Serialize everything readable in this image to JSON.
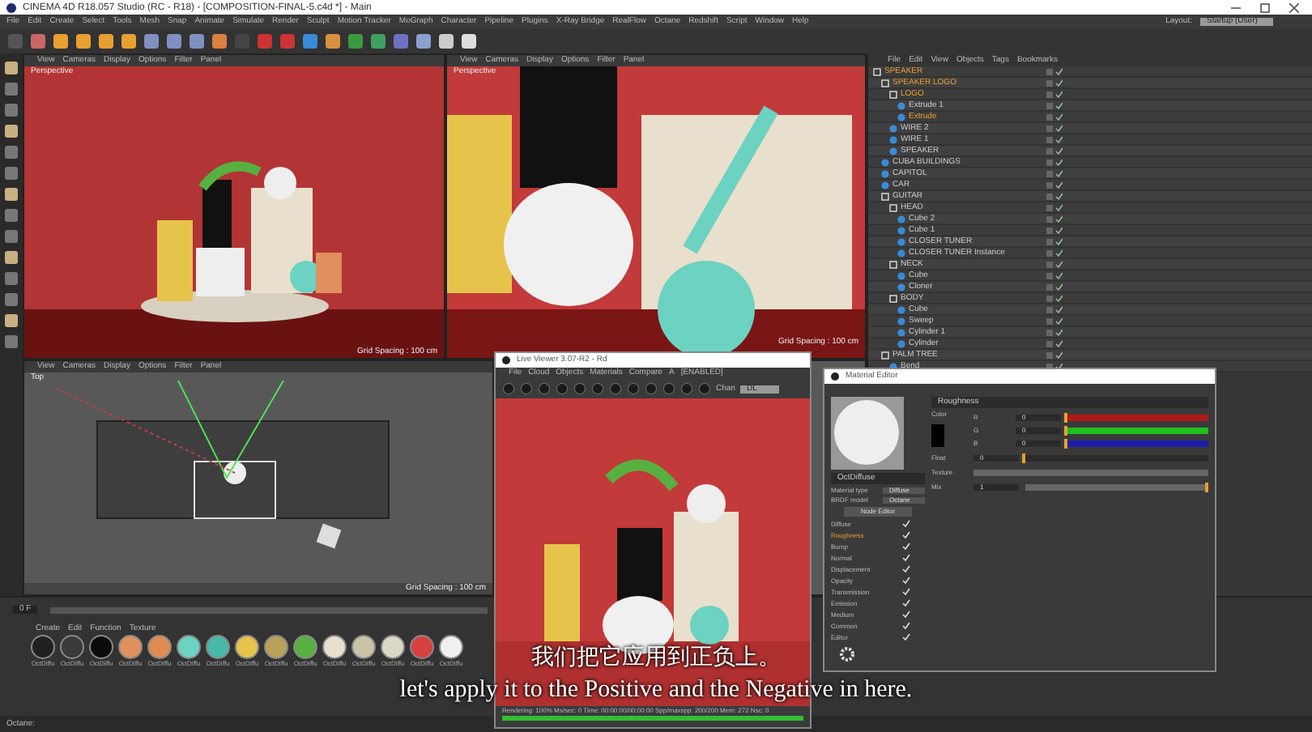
{
  "window": {
    "title": "CINEMA 4D R18.057 Studio (RC - R18) - [COMPOSITION-FINAL-5.c4d *] - Main"
  },
  "menu_bar": [
    "File",
    "Edit",
    "Create",
    "Select",
    "Tools",
    "Mesh",
    "Snap",
    "Animate",
    "Simulate",
    "Render",
    "Sculpt",
    "Motion Tracker",
    "MoGraph",
    "Character",
    "Pipeline",
    "Plugins",
    "X-Ray Bridge",
    "RealFlow",
    "Octane",
    "Redshift",
    "Script",
    "Window",
    "Help"
  ],
  "layout": {
    "label": "Layout:",
    "value": "Startup (User)"
  },
  "viewports": [
    {
      "kind": "perspective",
      "menu": [
        "View",
        "Cameras",
        "Display",
        "Options",
        "Filter",
        "Panel"
      ],
      "label": "Perspective",
      "grid": "Grid Spacing : 100 cm"
    },
    {
      "kind": "closeup",
      "menu": [
        "View",
        "Cameras",
        "Display",
        "Options",
        "Filter",
        "Panel"
      ],
      "label": "Perspective",
      "grid": "Grid Spacing : 100 cm"
    },
    {
      "kind": "top",
      "menu": [
        "View",
        "Cameras",
        "Display",
        "Options",
        "Filter",
        "Panel"
      ],
      "label": "Top",
      "grid": "Grid Spacing : 100 cm"
    }
  ],
  "object_manager": {
    "menu": [
      "File",
      "Edit",
      "View",
      "Objects",
      "Tags",
      "Bookmarks"
    ],
    "items": [
      {
        "name": "SPEAKER",
        "selected": true,
        "children": [
          {
            "name": "SPEAKER LOGO",
            "selected": true,
            "children": [
              {
                "name": "LOGO",
                "selected": true,
                "children": [
                  {
                    "name": "Extrude 1",
                    "selected": false
                  },
                  {
                    "name": "Extrude",
                    "selected": true
                  }
                ]
              },
              {
                "name": "WIRE 2",
                "selected": false
              },
              {
                "name": "WIRE 1",
                "selected": false
              },
              {
                "name": "SPEAKER",
                "selected": false
              }
            ]
          },
          {
            "name": "CUBA BUILDINGS",
            "selected": false
          },
          {
            "name": "CAPITOL",
            "selected": false
          },
          {
            "name": "CAR",
            "selected": false
          },
          {
            "name": "GUITAR",
            "selected": false,
            "children": [
              {
                "name": "HEAD",
                "selected": false,
                "children": [
                  {
                    "name": "Cube 2",
                    "selected": false
                  },
                  {
                    "name": "Cube 1",
                    "selected": false
                  },
                  {
                    "name": "CLOSER TUNER",
                    "selected": false
                  },
                  {
                    "name": "CLOSER TUNER Instance",
                    "selected": false
                  }
                ]
              },
              {
                "name": "NECK",
                "selected": false,
                "children": [
                  {
                    "name": "Cube",
                    "selected": false
                  },
                  {
                    "name": "Cloner",
                    "selected": false
                  }
                ]
              },
              {
                "name": "BODY",
                "selected": false,
                "children": [
                  {
                    "name": "Cube",
                    "selected": false
                  },
                  {
                    "name": "Sweep",
                    "selected": false
                  },
                  {
                    "name": "Cylinder 1",
                    "selected": false
                  },
                  {
                    "name": "Cylinder",
                    "selected": false
                  }
                ]
              }
            ]
          },
          {
            "name": "PALM TREE",
            "selected": false,
            "children": [
              {
                "name": "Bend",
                "selected": false
              }
            ]
          }
        ]
      }
    ]
  },
  "live_viewer": {
    "title": "Live Viewer 3.07-R2 - Rd",
    "menu": [
      "File",
      "Cloud",
      "Objects",
      "Materials",
      "Compare",
      "A",
      "[ENABLED]"
    ],
    "channel": {
      "label": "Chan",
      "value": "DL"
    },
    "status": "Rendering: 100%  Ms/sec: 0  Time: 00:00:00/00:00:00  Spp/maxspp: 200/200  Mem: 272  Nsc: 0",
    "progress": {
      "level": 1
    }
  },
  "material_editor": {
    "title": "Material Editor",
    "material_name": "OctDiffuse",
    "fields": [
      {
        "label": "Material type",
        "value": "Diffuse"
      },
      {
        "label": "BRDF model",
        "value": "Octane"
      }
    ],
    "node_editor": "Node Editor",
    "channels": [
      {
        "label": "Diffuse",
        "selected": false,
        "checked": true
      },
      {
        "label": "Roughness",
        "selected": true,
        "checked": true
      },
      {
        "label": "Bump",
        "selected": false,
        "checked": true
      },
      {
        "label": "Normal",
        "selected": false,
        "checked": true
      },
      {
        "label": "Displacement",
        "selected": false,
        "checked": true
      },
      {
        "label": "Opacity",
        "selected": false,
        "checked": true
      },
      {
        "label": "Transmission",
        "selected": false,
        "checked": true
      },
      {
        "label": "Emission",
        "selected": false,
        "checked": true
      },
      {
        "label": "Medium",
        "selected": false,
        "checked": true
      },
      {
        "label": "Common",
        "selected": false,
        "checked": true
      },
      {
        "label": "Editor",
        "selected": false,
        "checked": true
      }
    ],
    "section": "Roughness",
    "color_label": "Color",
    "rgb": [
      {
        "prefix": "R",
        "value": "0",
        "level": 0,
        "color": "#b01818"
      },
      {
        "prefix": "G",
        "value": "0",
        "level": 0,
        "color": "#20c020"
      },
      {
        "prefix": "B",
        "value": "0",
        "level": 0,
        "color": "#1c1ca8"
      }
    ],
    "float": {
      "label": "Float",
      "value": "0",
      "level": 0
    },
    "texture": {
      "label": "Texture"
    },
    "mix": {
      "label": "Mix",
      "value": "1",
      "level": 1
    }
  },
  "timeline": {
    "frame": "0 F"
  },
  "materials": {
    "menu": [
      "Create",
      "Edit",
      "Function",
      "Texture"
    ],
    "items": [
      {
        "name": "OctDiffu",
        "color": "#202020"
      },
      {
        "name": "OctDiffu",
        "color": "#3a3a3a"
      },
      {
        "name": "OctDiffu",
        "color": "#0c0c0c"
      },
      {
        "name": "OctDiffu",
        "color": "#e0905c"
      },
      {
        "name": "OctDiffu",
        "color": "#e08c50"
      },
      {
        "name": "OctDiffu",
        "color": "#6cd2c2"
      },
      {
        "name": "OctDiffu",
        "color": "#48b8a8"
      },
      {
        "name": "OctDiffu",
        "color": "#e6c44c"
      },
      {
        "name": "OctDiffu",
        "color": "#b8a258"
      },
      {
        "name": "OctDiffu",
        "color": "#58b040"
      },
      {
        "name": "OctDiffu",
        "color": "#e6e0cc"
      },
      {
        "name": "OctDiffu",
        "color": "#c8c4a8"
      },
      {
        "name": "OctDiffu",
        "color": "#dcd8c8"
      },
      {
        "name": "OctDiffu",
        "color": "#d84040"
      },
      {
        "name": "OctDiffu",
        "color": "#f0f0f0"
      }
    ]
  },
  "subtitles": [
    "我们把它应用到正负上。",
    "let's apply it to the Positive and the Negative in here."
  ],
  "status_bar": "Octane:"
}
